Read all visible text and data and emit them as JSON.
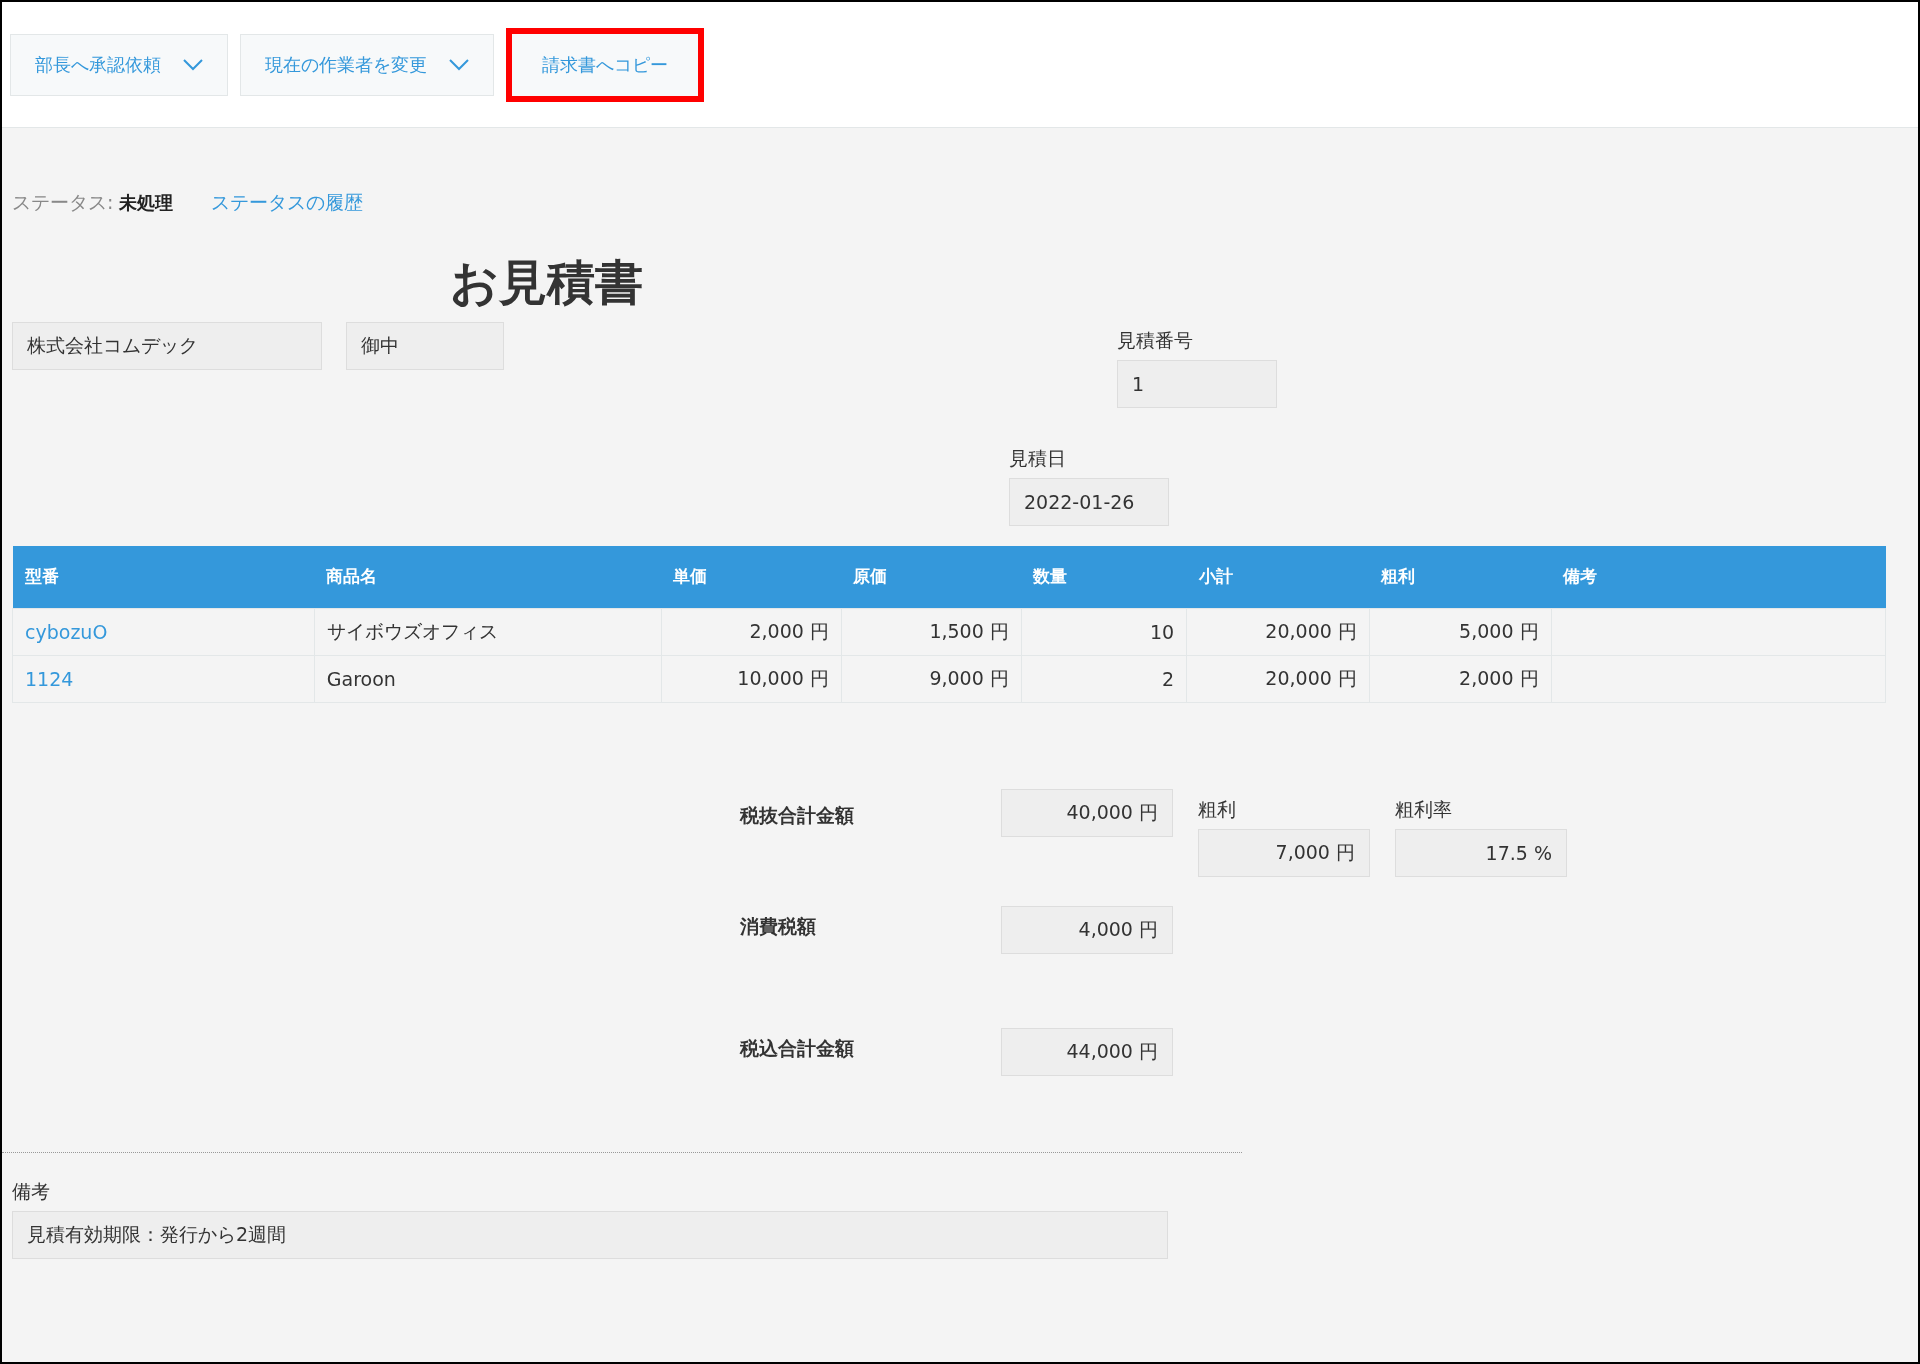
{
  "toolbar": {
    "buttons": [
      {
        "label": "部長へ承認依頼",
        "kind": "dropdown",
        "highlighted": false
      },
      {
        "label": "現在の作業者を変更",
        "kind": "dropdown",
        "highlighted": false
      },
      {
        "label": "請求書へコピー",
        "kind": "plain",
        "highlighted": true
      }
    ]
  },
  "status": {
    "label": "ステータス:",
    "value": "未処理",
    "history_link": "ステータスの履歴"
  },
  "title": "お見積書",
  "customer": {
    "name": "株式会社コムデック",
    "honorific": "御中"
  },
  "estimate_number": {
    "label": "見積番号",
    "value": "1"
  },
  "estimate_date": {
    "label": "見積日",
    "value": "2022-01-26"
  },
  "table": {
    "columns": [
      "型番",
      "商品名",
      "単価",
      "原価",
      "数量",
      "小計",
      "粗利",
      "備考"
    ],
    "rows": [
      {
        "cells": [
          "cybozuO",
          "サイボウズオフィス",
          "2,000 円",
          "1,500 円",
          "10",
          "20,000 円",
          "5,000 円"
        ]
      },
      {
        "cells": [
          "1124",
          "Garoon",
          "10,000 円",
          "9,000 円",
          "2",
          "20,000 円",
          "2,000 円"
        ]
      }
    ]
  },
  "summary": {
    "subtotal": {
      "label": "税抜合計金額",
      "value": "40,000 円"
    },
    "gross_profit": {
      "label": "粗利",
      "value": "7,000 円"
    },
    "margin_rate": {
      "label": "粗利率",
      "value": "17.5 %"
    },
    "tax": {
      "label": "消費税額",
      "value": "4,000 円"
    },
    "total": {
      "label": "税込合計金額",
      "value": "44,000 円"
    }
  },
  "notes": {
    "label": "備考",
    "value": "見積有効期限：発行から2週間"
  }
}
